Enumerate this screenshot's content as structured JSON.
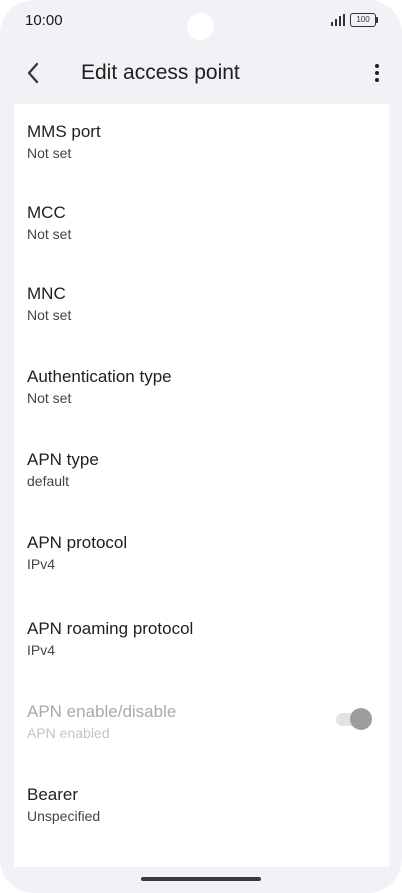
{
  "status_bar": {
    "time": "10:00",
    "battery": "100"
  },
  "app_bar": {
    "title": "Edit access point"
  },
  "items": [
    {
      "title": "MMS port",
      "value": "Not set"
    },
    {
      "title": "MCC",
      "value": "Not set"
    },
    {
      "title": "MNC",
      "value": "Not set"
    },
    {
      "title": "Authentication type",
      "value": "Not set"
    },
    {
      "title": "APN type",
      "value": "default"
    },
    {
      "title": "APN protocol",
      "value": "IPv4"
    },
    {
      "title": "APN roaming protocol",
      "value": "IPv4"
    },
    {
      "title": "APN enable/disable",
      "value": "APN enabled",
      "toggle_on": true,
      "enabled": false
    },
    {
      "title": "Bearer",
      "value": "Unspecified"
    }
  ],
  "icons": {
    "back": "chevron-left-icon",
    "menu": "more-vertical-icon",
    "signal": "signal-icon",
    "battery": "battery-icon"
  }
}
